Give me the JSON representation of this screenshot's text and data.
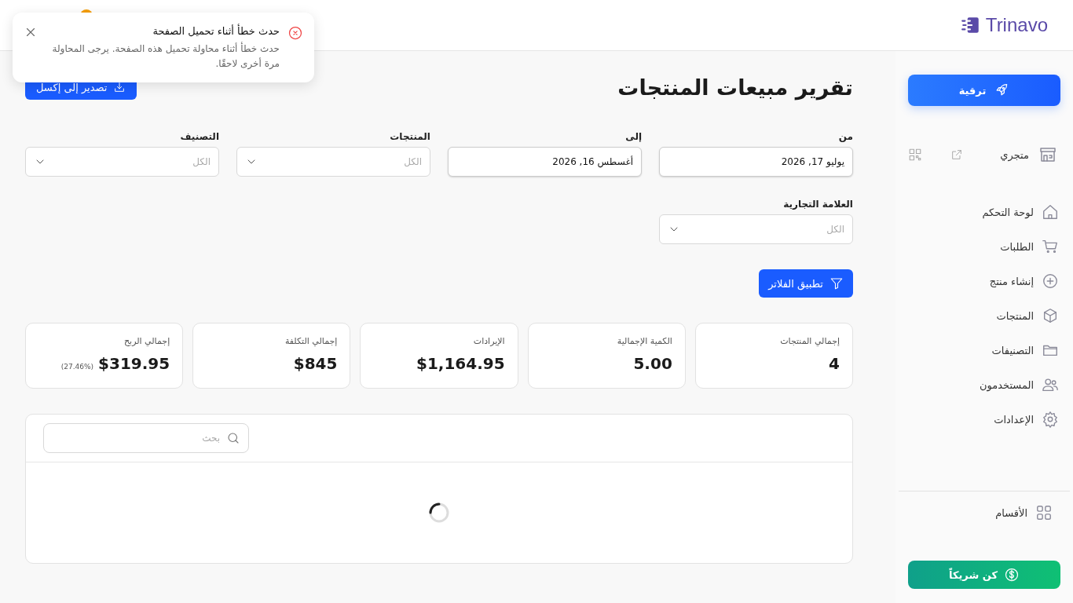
{
  "header": {
    "logo_text": "Trinavo"
  },
  "toast": {
    "title": "حدث خطأ أثناء تحميل الصفحة",
    "message": "حدث خطأ أثناء محاولة تحميل هذه الصفحة. يرجى المحاولة مرة أخرى لاحقًا."
  },
  "sidebar": {
    "upgrade_button": "ترقية",
    "store_label": "متجري",
    "items": [
      {
        "label": "لوحة التحكم"
      },
      {
        "label": "الطلبات"
      },
      {
        "label": "إنشاء منتج"
      },
      {
        "label": "المنتجات"
      },
      {
        "label": "التصنيفات"
      },
      {
        "label": "المستخدمون"
      },
      {
        "label": "الإعدادات"
      }
    ],
    "sections_item": "الأقسام",
    "partner_button": "كن شريكاً"
  },
  "page": {
    "title": "تقرير مبيعات المنتجات",
    "export_button": "تصدير إلى إكسل"
  },
  "filters": [
    {
      "kind": "date",
      "label": "من",
      "value": "يوليو 17, 2026"
    },
    {
      "kind": "date",
      "label": "إلى",
      "value": "أغسطس 16, 2026"
    },
    {
      "kind": "select",
      "label": "المنتجات",
      "placeholder": "الكل"
    },
    {
      "kind": "select",
      "label": "التصنيف",
      "placeholder": "الكل"
    },
    {
      "kind": "select",
      "label": "العلامة التجارية",
      "placeholder": "الكل"
    }
  ],
  "apply_button": "تطبيق الفلاتر",
  "stats": [
    {
      "label": "إجمالي المنتجات",
      "value": "4"
    },
    {
      "label": "الكمية الإجمالية",
      "value": "5.00"
    },
    {
      "label": "الإيرادات",
      "value": "$1,164.95"
    },
    {
      "label": "إجمالي التكلفة",
      "value": "$845"
    },
    {
      "label": "إجمالي الربح",
      "value": "$319.95",
      "note": "(27.46%)"
    }
  ],
  "table": {
    "search_placeholder": "بحث",
    "loading": true
  }
}
